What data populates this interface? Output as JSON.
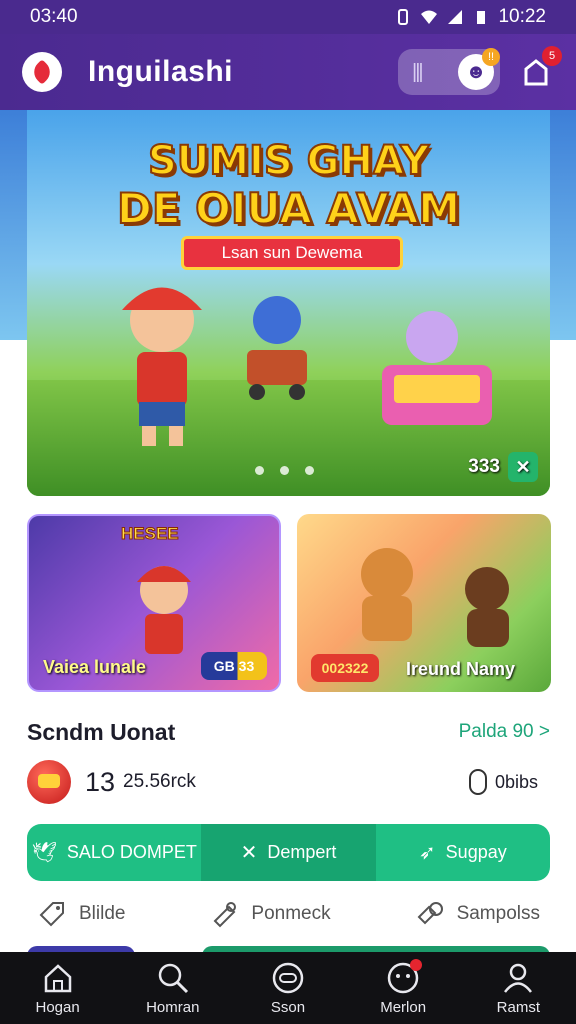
{
  "status_bar": {
    "time": "03:40",
    "clock": "10:22"
  },
  "app_bar": {
    "title": "Inguilashi",
    "promo_badge": "!!",
    "cart_badge": "5"
  },
  "hero": {
    "title_line1": "SUMIS GHAY",
    "title_line2": "DE OIUA AVAM",
    "subtitle": "Lsan sun Dewema",
    "count": "333"
  },
  "cards": [
    {
      "tag": "HESEE",
      "title": "Vaiea lunale",
      "pill": "GB 33"
    },
    {
      "title": "Ireund Namy",
      "pill": "002322"
    }
  ],
  "section": {
    "title": "Scndm Uonat",
    "link": "Palda 90 >"
  },
  "balance": {
    "amount": "13",
    "unit": "25.56rck",
    "points": "0bibs"
  },
  "actions": [
    {
      "label": "SALO DOMPET",
      "icon": "bird-icon"
    },
    {
      "label": "Dempert",
      "icon": "close-icon"
    },
    {
      "label": "Sugpay",
      "icon": "send-icon"
    }
  ],
  "utilities": [
    {
      "label": "Blilde",
      "icon": "tag-icon"
    },
    {
      "label": "Ponmeck",
      "icon": "ticket-icon"
    },
    {
      "label": "Sampolss",
      "icon": "search-tag-icon"
    }
  ],
  "nav": [
    {
      "label": "Hogan",
      "icon": "home-icon"
    },
    {
      "label": "Homran",
      "icon": "search-icon"
    },
    {
      "label": "Sson",
      "icon": "gamepad-icon"
    },
    {
      "label": "Merlon",
      "icon": "chat-icon"
    },
    {
      "label": "Ramst",
      "icon": "profile-icon"
    }
  ],
  "colors": {
    "primary": "#4b2a90",
    "accent": "#1fbf84",
    "nav_bg": "#111114"
  }
}
